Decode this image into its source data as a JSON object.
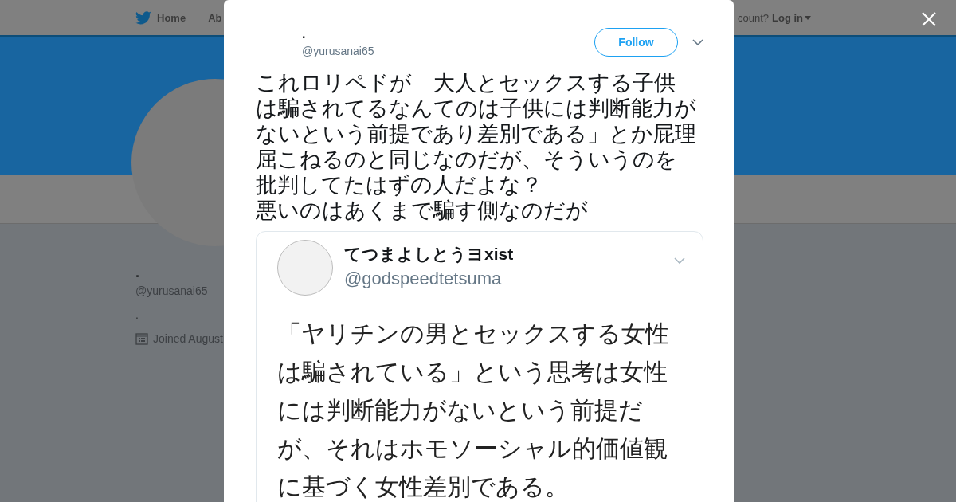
{
  "nav": {
    "items": [
      {
        "label": "Home"
      },
      {
        "label": "Ab"
      }
    ],
    "account_prompt": "count?",
    "login": "Log in"
  },
  "profile": {
    "name": ".",
    "handle": "@yurusanai65",
    "bio": ".",
    "joined": "Joined August"
  },
  "tweet": {
    "name": ".",
    "handle": "@yurusanai65",
    "follow": "Follow",
    "text_lines": [
      "これロリペドが「大人とセックスする子供",
      "は騙されてるなんてのは子供には判断能力が",
      "ないという前提であり差別である」とか屁理",
      "屈こねるのと同じなのだが、そういうのを",
      "批判してたはずの人だよな？",
      "悪いのはあくまで騙す側なのだが"
    ],
    "quoted_image": {
      "name": "てつまよしとうヨxist",
      "handle": "@godspeedtetsuma",
      "text_lines": [
        "「ヤリチンの男とセックスする女性",
        "は騙されている」という思考は女性",
        "には判断能力がないという前提だ",
        "が、それはホモソーシャル的価値観",
        "に基づく女性差別である。"
      ]
    }
  }
}
